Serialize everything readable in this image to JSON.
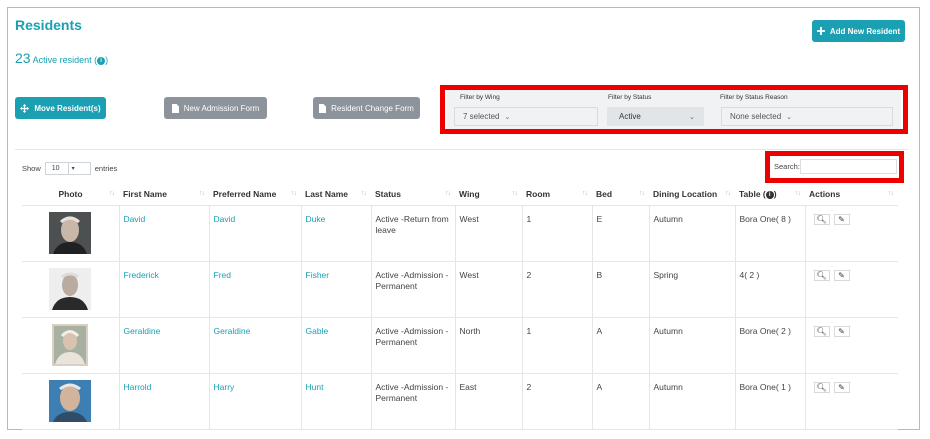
{
  "page": {
    "title": "Residents",
    "count_number": "23",
    "count_label": "Active resident (",
    "count_suffix": ")",
    "info_glyph": "i"
  },
  "buttons": {
    "add_resident": "Add New Resident",
    "move_residents": "Move Resident(s)",
    "new_admission_form": "New Admission Form",
    "resident_change_form": "Resident Change Form"
  },
  "filters": {
    "wing_label": "Filter by Wing",
    "wing_value": "7 selected",
    "status_label": "Filter by Status",
    "status_value": "Active",
    "reason_label": "Filter by Status Reason",
    "reason_value": "None selected"
  },
  "table_controls": {
    "show_label": "Show",
    "show_value": "10",
    "entries_label": "entries",
    "search_label": "Search:",
    "search_value": ""
  },
  "columns": [
    "Photo",
    "First Name",
    "Preferred Name",
    "Last Name",
    "Status",
    "Wing",
    "Room",
    "Bed",
    "Dining Location",
    "Table (",
    "Actions"
  ],
  "table_col_suffix": ")",
  "rows": [
    {
      "first": "David",
      "preferred": "David",
      "last": "Duke",
      "status": "Active -Return from leave",
      "wing": "West",
      "room": "1",
      "bed": "E",
      "dining": "Autumn",
      "table": "Bora One( 8 )"
    },
    {
      "first": "Frederick",
      "preferred": "Fred",
      "last": "Fisher",
      "status": "Active -Admission - Permanent",
      "wing": "West",
      "room": "2",
      "bed": "B",
      "dining": "Spring",
      "table": "4( 2 )"
    },
    {
      "first": "Geraldine",
      "preferred": "Geraldine",
      "last": "Gable",
      "status": "Active -Admission - Permanent",
      "wing": "North",
      "room": "1",
      "bed": "A",
      "dining": "Autumn",
      "table": "Bora One( 2 )"
    },
    {
      "first": "Harrold",
      "preferred": "Harry",
      "last": "Hunt",
      "status": "Active -Admission - Permanent",
      "wing": "East",
      "room": "2",
      "bed": "A",
      "dining": "Autumn",
      "table": "Bora One( 1 )"
    }
  ],
  "colors": {
    "accent": "#1aa0b2",
    "secondary_button": "#8c939b",
    "highlight_red": "#ee0000"
  },
  "icons": [
    "plus-icon",
    "move-icon",
    "document-icon",
    "info-icon",
    "search-icon",
    "edit-icon",
    "sort-icon"
  ]
}
